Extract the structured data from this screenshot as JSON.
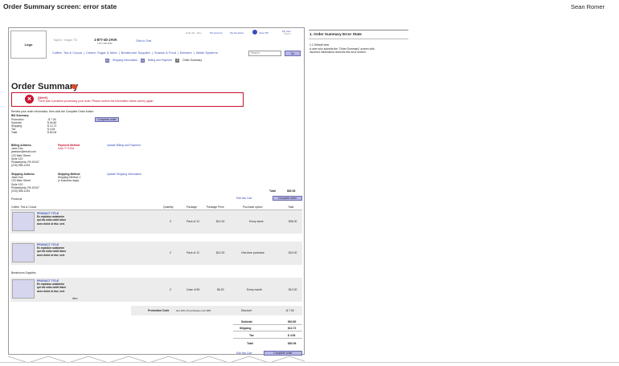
{
  "page": {
    "title": "Order Summary screen: error state",
    "author": "Sean Romer"
  },
  "annotation": {
    "title": "1. Order Summary Error State",
    "subtitle": "1.1 Default view",
    "body_1": "A user who submits the \"Order Summary\" screen with",
    "body_2": "incorrect information receives this error screen."
  },
  "header": {
    "logo": "Logo",
    "tagline": "Tagline / Slogan TM",
    "phone": "1-877-40-JAVA",
    "phone_sub": "1-877-405-2842",
    "chat": "Click to Chat",
    "greeting": "Hello Ms. Jane",
    "my_account": "My Account",
    "my_favorites": "My Favorites",
    "java_vip": "Java VIP",
    "my_cart": "My Cart",
    "cart_items": "3 items",
    "nav": [
      "Coffee, Tea & Cocoa",
      "Cream, Sugar & More",
      "Breakroom Supplies",
      "Snacks & Food",
      "Brewers",
      "Water Systems"
    ],
    "search_placeholder": "Search",
    "search_button": "Go"
  },
  "steps": [
    {
      "num": "1",
      "label": "Shipping Information"
    },
    {
      "num": "2",
      "label": "Billing and Payment"
    },
    {
      "num": "3",
      "label": "Order Summary"
    }
  ],
  "main": {
    "heading": "Order Summary",
    "alert_title": "[Alert]",
    "alert_message": "There was a problem processing your order. Please confirm the information below and try again.",
    "review_text": "Review your order information, then click the Complete Order button",
    "complete_order": "Complete order",
    "bill_summary": {
      "title": "Bill Summary",
      "labels": [
        "Promotion",
        "Subtotal",
        "Shipping",
        "Tax",
        "Total"
      ],
      "values": [
        "-$  7.26",
        "$ 64.80",
        "$ 12.72",
        "$   4.54",
        "$ 82.06"
      ]
    },
    "billing": {
      "title": "Billing Address",
      "lines": [
        "Jane Doe",
        "janedoe@email.com",
        "123 Main Street",
        "Suite 120",
        "Philadelphia, PA  19107",
        "(215) 555-1234"
      ],
      "payment_title": "Payment Method",
      "payment_value": "Visa ****1234",
      "update_link": "Update Billing and Payment"
    },
    "shipping": {
      "title": "Shipping Address",
      "lines": [
        "Jane Doe",
        "123 Main Street",
        "Suite 120",
        "Philadelphia, PA  19107",
        "(215) 555-1234"
      ],
      "method_title": "Shipping Method",
      "method_lines": [
        "Shipping Method 1",
        "(x business days)"
      ],
      "update_link": "Update Shipping Information"
    },
    "products_label": "Products",
    "edit_cart": "Edit this Cart",
    "total_label": "Total",
    "total_value": "$82.06",
    "columns": [
      "Quantity",
      "Package",
      "Package Price",
      "Purchase option",
      "Total"
    ],
    "category_1": "Coffee, Tea & Cocoa",
    "category_2": "Breakroom Supplies",
    "products": [
      {
        "title": "PRODUCT TITLE",
        "desc": [
          "Ex explabor autatenim",
          "qui dis naliu nobit labor",
          "aceo dolut ut etur, sed."
        ],
        "qty": "3",
        "package": "Pack of 12",
        "price": "$12.00",
        "option": "Every week",
        "total": "$36.00"
      },
      {
        "title": "PRODUCT TITLE",
        "desc": [
          "Ex explabor autatenim",
          "qui dis naliu nobit labor",
          "aceo dolut ut etur, sed."
        ],
        "qty": "2",
        "package": "Pack of 12",
        "price": "$12.00",
        "option": "One-time purchase",
        "total": "$24.00"
      },
      {
        "title": "PRODUCT TITLE",
        "desc": [
          "Ex explabor autatenim",
          "qui dis naliu nobit labor",
          "aceo dolut ut etur, sed."
        ],
        "extra": "item",
        "qty": "2",
        "package": "Case of 50",
        "price": "$6.00",
        "option": "Every month",
        "total": "$12.00"
      }
    ],
    "promo_label": "Promotion Code",
    "promo_text": "Get 10% off purchases over $55.",
    "discount_label": "Discount",
    "discount_value": "-$ 7.26",
    "totals": {
      "labels": [
        "Subtotal",
        "Shipping",
        "Tax",
        "Total"
      ],
      "values": [
        "$64.80",
        "$12.72",
        "$ 4.54",
        "$82.06"
      ]
    }
  },
  "colors": {
    "accent": "#3a4fb8",
    "error": "#c8102e",
    "button": "#b8b8e8"
  }
}
